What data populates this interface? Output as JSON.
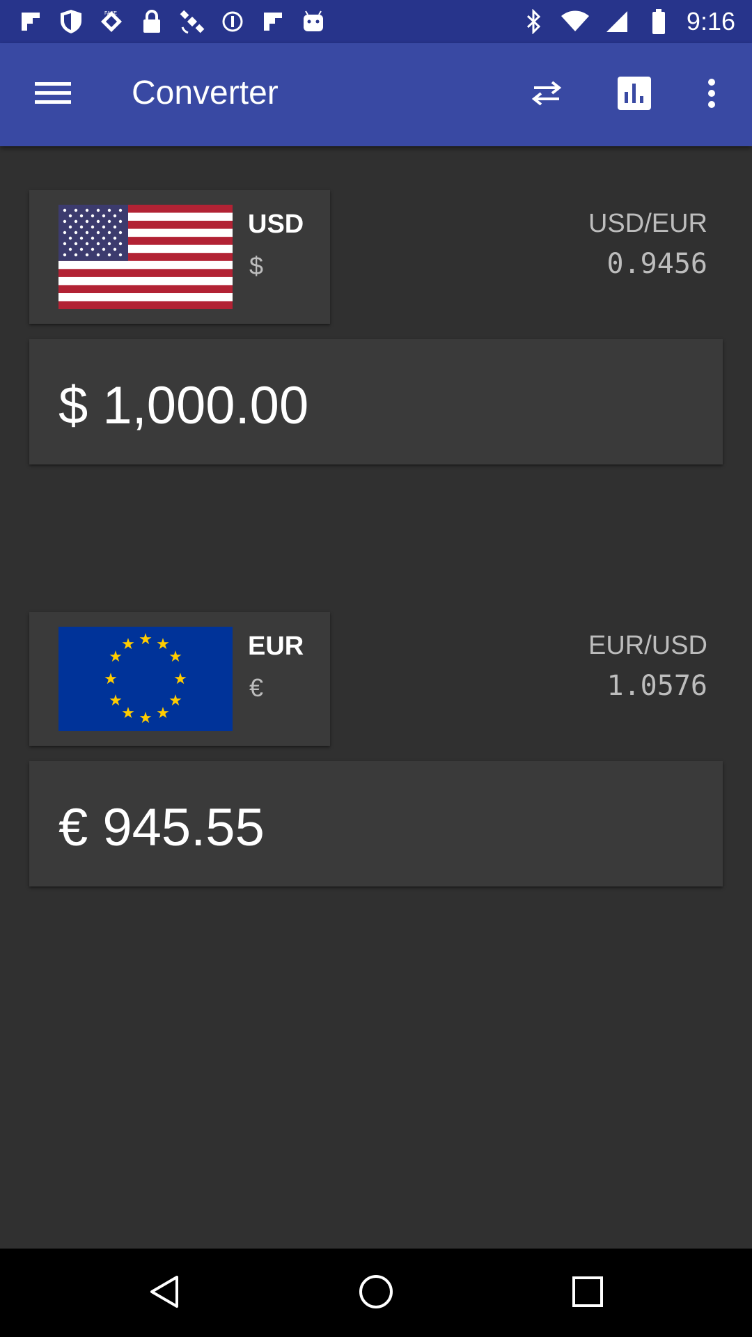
{
  "status_bar": {
    "time": "9:16",
    "left_icons": [
      "flipboard-icon",
      "shield-icon",
      "fakegps-icon",
      "lock-icon",
      "satellite-icon",
      "circle-icon",
      "flipboard-icon",
      "android-icon"
    ],
    "right_icons": [
      "bluetooth-icon",
      "wifi-icon",
      "signal-icon",
      "battery-icon"
    ]
  },
  "app_bar": {
    "title": "Converter",
    "background": "#3949a3",
    "actions": [
      "menu-icon",
      "swap-icon",
      "chart-icon",
      "more-vert-icon"
    ]
  },
  "from": {
    "code": "USD",
    "symbol": "$",
    "rate_pair": "USD/EUR",
    "rate_value": "0.9456",
    "amount": "$ 1,000.00",
    "flag": "us-flag-icon"
  },
  "to": {
    "code": "EUR",
    "symbol": "€",
    "rate_pair": "EUR/USD",
    "rate_value": "1.0576",
    "amount": "€ 945.55",
    "flag": "eu-flag-icon"
  },
  "nav_bar": {
    "buttons": [
      "back-icon",
      "home-icon",
      "recents-icon"
    ]
  }
}
